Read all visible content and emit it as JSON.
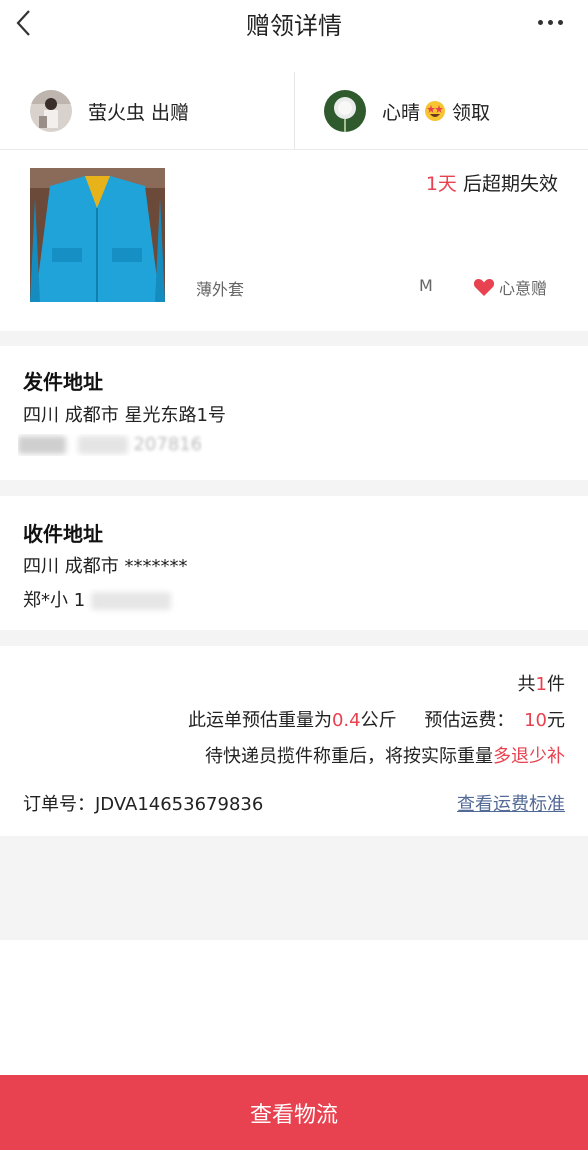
{
  "header": {
    "title": "赠领详情"
  },
  "giver": {
    "name": "萤火虫",
    "action": "出赠"
  },
  "receiver": {
    "name": "心晴",
    "action": "领取"
  },
  "item": {
    "expire_num": "1天",
    "expire_text": "后超期失效",
    "name": "薄外套",
    "size": "M",
    "tag": "心意赠"
  },
  "sender_address": {
    "title": "发件地址",
    "line1": "四川 成都市 星光东路1号",
    "phone_partial": "207816"
  },
  "receiver_address": {
    "title": "收件地址",
    "line1": "四川 成都市 *******",
    "name_partial": "郑*小 1"
  },
  "summary": {
    "count_prefix": "共",
    "count": "1",
    "count_suffix": "件",
    "weight_prefix": "此运单预估重量为",
    "weight": "0.4",
    "weight_unit": "公斤",
    "fee_label": "预估运费：",
    "fee": "10",
    "fee_unit": "元",
    "note_prefix": "待快递员揽件称重后，将按实际重量",
    "note_highlight": "多退少补"
  },
  "order": {
    "label": "订单号：",
    "number": "JDVA14653679836"
  },
  "links": {
    "fee_standard": "查看运费标准"
  },
  "footer": {
    "button": "查看物流"
  },
  "colors": {
    "accent": "#e8414f",
    "link": "#536a96",
    "gap": "#f4f4f4"
  }
}
